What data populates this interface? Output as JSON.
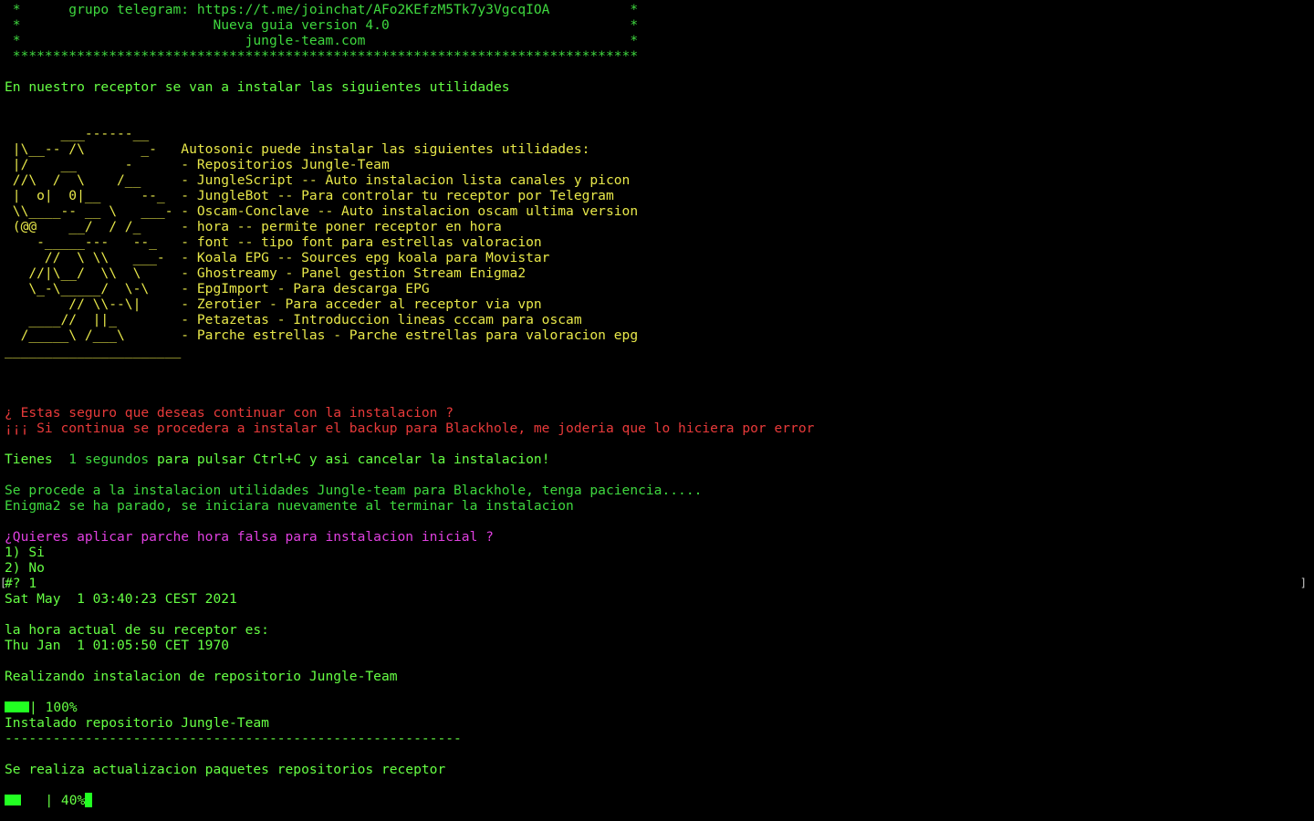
{
  "banner": {
    "telegram": " *      grupo telegram: https://t.me/joinchat/AFo2KEfzM5Tk7y3VgcqIOA          *",
    "guide": " *                        Nueva guia version 4.0                              *",
    "site": " *                            jungle-team.com                                 *",
    "stars": " ******************************************************************************"
  },
  "intro": "En nuestro receptor se van a instalar las siguientes utilidades",
  "art": [
    "       ___------__",
    " |\\__-- /\\       _-   ",
    " |/    __      -      ",
    " //\\  /  \\    /__     ",
    " |  o|  0|__     --_  ",
    " \\\\____-- __ \\   ___- ",
    " (@@    __/  / /_     ",
    "    -_____---   --_   ",
    "     //  \\ \\\\   ___-  ",
    "   //|\\__/  \\\\  \\     ",
    "   \\_-\\_____/  \\-\\    ",
    "        // \\\\--\\|     ",
    "   ____//  ||_        ",
    "  /_____\\ /___\\       ",
    "______________________"
  ],
  "utilities": [
    "",
    "Autosonic puede instalar las siguientes utilidades:",
    "- Repositorios Jungle-Team",
    "- JungleScript -- Auto instalacion lista canales y picon",
    "- JungleBot -- Para controlar tu receptor por Telegram",
    "- Oscam-Conclave -- Auto instalacion oscam ultima version",
    "- hora -- permite poner receptor en hora",
    "- font -- tipo font para estrellas valoracion",
    "- Koala EPG -- Sources epg koala para Movistar",
    "- Ghostreamy - Panel gestion Stream Enigma2",
    "- EpgImport - Para descarga EPG",
    "- Zerotier - Para acceder al receptor via vpn",
    "- Petazetas - Introduccion lineas cccam para oscam",
    "- Parche estrellas - Parche estrellas para valoracion epg",
    ""
  ],
  "warning": {
    "question": "¿ Estas seguro que deseas continuar con la instalacion ?",
    "note": "¡¡¡ Si continua se procedera a instalar el backup para Blackhole, me joderia que lo hiciera por error"
  },
  "countdown": {
    "prefix": "Tienes ",
    "seconds": " 1 segundos",
    "suffix": " para pulsar Ctrl+C y asi cancelar la instalacion!"
  },
  "install": {
    "proceed": "Se procede a la instalacion utilidades Jungle-team para Blackhole, tenga paciencia.....",
    "enigma": "Enigma2 se ha parado, se iniciara nuevamente al terminar la instalacion"
  },
  "patch_prompt": {
    "question": "¿Quieres aplicar parche hora falsa para instalacion inicial ?",
    "option1": "1) Si",
    "option2": "2) No",
    "answer": "#? 1"
  },
  "dates": {
    "now": "Sat May  1 03:40:23 CEST 2021",
    "receiver_label": "la hora actual de su receptor es:",
    "receiver": "Thu Jan  1 01:05:50 CET 1970"
  },
  "repo": {
    "doing": "Realizando instalacion de repositorio Jungle-Team",
    "progress_text": "| 100%",
    "progress_value": 1.0,
    "done": "Instalado repositorio Jungle-Team",
    "separator": "---------------------------------------------------------"
  },
  "update": {
    "doing": "Se realiza actualizacion paquetes repositorios receptor",
    "progress_text": "   | 40%",
    "progress_value": 0.4
  },
  "markers": {
    "left": "[",
    "right": "]"
  },
  "colors": {
    "background": "#000000",
    "text_green": "#3fd83f",
    "bright_green": "#66ff44",
    "ascii_yellow": "#e8e84a",
    "warning_red": "#e83a3a",
    "prompt_magenta": "#e040e0"
  }
}
